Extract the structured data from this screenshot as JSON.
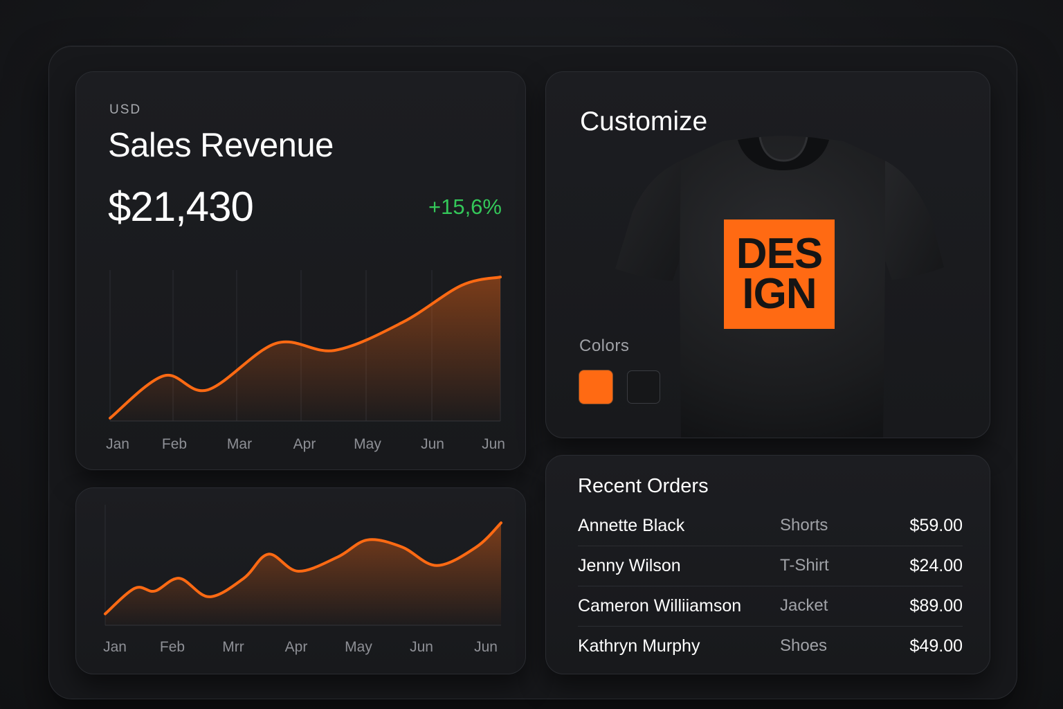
{
  "sales": {
    "currency": "USD",
    "title": "Sales Revenue",
    "value": "$21,430",
    "change": "+15,6%"
  },
  "chart_data": [
    {
      "type": "area",
      "categories": [
        "Jan",
        "Feb",
        "Mar",
        "Apr",
        "May",
        "Jun",
        "Jun"
      ],
      "values": [
        2,
        32,
        22,
        55,
        50,
        70,
        102
      ],
      "curve": [
        [
          0,
          2
        ],
        [
          0.55,
          32
        ],
        [
          1,
          22
        ],
        [
          1.7,
          55
        ],
        [
          2.3,
          50
        ],
        [
          3,
          70
        ],
        [
          3.6,
          96
        ],
        [
          4,
          102
        ]
      ],
      "accent": "#ff6a13",
      "grid": "vertical"
    },
    {
      "type": "area",
      "categories": [
        "Jan",
        "Feb",
        "Mrr",
        "Apr",
        "May",
        "Jun",
        "Jun"
      ],
      "values": [
        8,
        26,
        23,
        48,
        48,
        38,
        72
      ],
      "curve": [
        [
          0,
          8
        ],
        [
          0.3,
          26
        ],
        [
          0.5,
          24
        ],
        [
          0.75,
          33
        ],
        [
          1.05,
          20
        ],
        [
          1.4,
          33
        ],
        [
          1.65,
          50
        ],
        [
          1.95,
          38
        ],
        [
          2.35,
          48
        ],
        [
          2.65,
          60
        ],
        [
          3.0,
          55
        ],
        [
          3.35,
          42
        ],
        [
          3.75,
          55
        ],
        [
          4.0,
          72
        ]
      ],
      "accent": "#ff6a13"
    }
  ],
  "customize": {
    "title": "Customize",
    "design_text": [
      "DES",
      "IGN"
    ],
    "colors_label": "Colors",
    "colors": [
      "#ff6a13",
      "#161719"
    ]
  },
  "orders": {
    "title": "Recent Orders",
    "rows": [
      {
        "name": "Annette Black",
        "product": "Shorts",
        "amount": "$59.00"
      },
      {
        "name": "Jenny Wilson",
        "product": "T-Shirt",
        "amount": "$24.00"
      },
      {
        "name": "Cameron Williiamson",
        "product": "Jacket",
        "amount": "$89.00"
      },
      {
        "name": "Kathryn Murphy",
        "product": "Shoes",
        "amount": "$49.00"
      }
    ]
  }
}
